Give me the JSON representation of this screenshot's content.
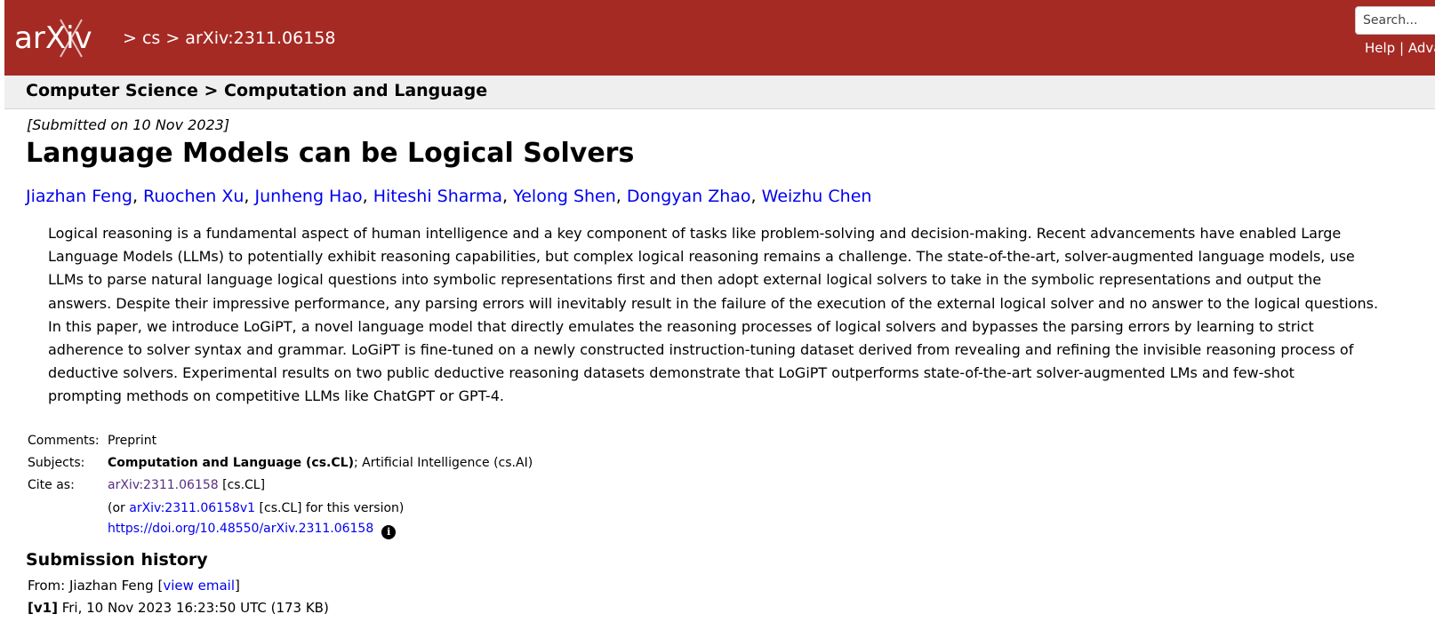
{
  "header": {
    "logo_text": "arXiv",
    "breadcrumb": "> cs > arXiv:2311.06158",
    "search_placeholder": "Search...",
    "help_label": "Help",
    "separator": "|",
    "advanced_label": "Adva"
  },
  "subheader": {
    "text": "Computer Science > Computation and Language"
  },
  "paper": {
    "dateline": "[Submitted on 10 Nov 2023]",
    "title": "Language Models can be Logical Solvers",
    "authors": [
      "Jiazhan Feng",
      "Ruochen Xu",
      "Junheng Hao",
      "Hiteshi Sharma",
      "Yelong Shen",
      "Dongyan Zhao",
      "Weizhu Chen"
    ],
    "abstract_lines": [
      "Logical reasoning is a fundamental aspect of human intelligence and a key component of tasks like problem-solving and decision-making. Recent advancements have enabled Large",
      "Language Models (LLMs) to potentially exhibit reasoning capabilities, but complex logical reasoning remains a challenge. The state-of-the-art, solver-augmented language models, use",
      "LLMs to parse natural language logical questions into symbolic representations first and then adopt external logical solvers to take in the symbolic representations and output the",
      "answers. Despite their impressive performance, any parsing errors will inevitably result in the failure of the execution of the external logical solver and no answer to the logical questions.",
      "In this paper, we introduce LoGiPT, a novel language model that directly emulates the reasoning processes of logical solvers and bypasses the parsing errors by learning to strict",
      "adherence to solver syntax and grammar. LoGiPT is fine-tuned on a newly constructed instruction-tuning dataset derived from revealing and refining the invisible reasoning process of",
      "deductive solvers. Experimental results on two public deductive reasoning datasets demonstrate that LoGiPT outperforms state-of-the-art solver-augmented LMs and few-shot",
      "prompting methods on competitive LLMs like ChatGPT or GPT-4."
    ]
  },
  "meta": {
    "comments_label": "Comments:",
    "comments_value": "Preprint",
    "subjects_label": "Subjects:",
    "subjects_primary": "Computation and Language (cs.CL)",
    "subjects_rest": "; Artificial Intelligence (cs.AI)",
    "cite_label": "Cite as:",
    "cite_link": "arXiv:2311.06158",
    "cite_suffix": " [cs.CL]",
    "version_prefix": "(or ",
    "version_link": "arXiv:2311.06158v1",
    "version_suffix": " [cs.CL] for this version)",
    "doi_link": "https://doi.org/10.48550/arXiv.2311.06158",
    "info_icon_glyph": "i"
  },
  "history": {
    "title": "Submission history",
    "from_prefix": "From: Jiazhan Feng [",
    "view_email": "view email",
    "from_suffix": "]",
    "v1_label": "[v1]",
    "v1_text": " Fri, 10 Nov 2023 16:23:50 UTC (173 KB)"
  },
  "colors": {
    "header_bg": "#a52a24",
    "link": "#0000ee",
    "visited_link": "#5a2d82",
    "subheader_bg": "#efefef"
  }
}
